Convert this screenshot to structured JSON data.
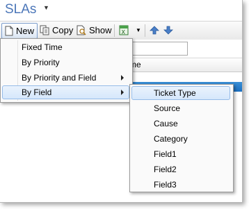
{
  "app": {
    "title": "SLAs"
  },
  "toolbar": {
    "new_label": "New",
    "copy_label": "Copy",
    "show_label": "Show"
  },
  "grid": {
    "header_label": "me"
  },
  "menu": {
    "items": [
      {
        "label": "Fixed Time"
      },
      {
        "label": "By Priority"
      },
      {
        "label": "By Priority and Field"
      },
      {
        "label": "By Field"
      }
    ]
  },
  "submenu": {
    "items": [
      {
        "label": "Ticket Type"
      },
      {
        "label": "Source"
      },
      {
        "label": "Cause"
      },
      {
        "label": "Category"
      },
      {
        "label": "Field1"
      },
      {
        "label": "Field2"
      },
      {
        "label": "Field3"
      }
    ]
  },
  "colors": {
    "title": "#4b76b8",
    "highlight": "#d5e7fb",
    "selected_row": "#1b6fc0"
  }
}
